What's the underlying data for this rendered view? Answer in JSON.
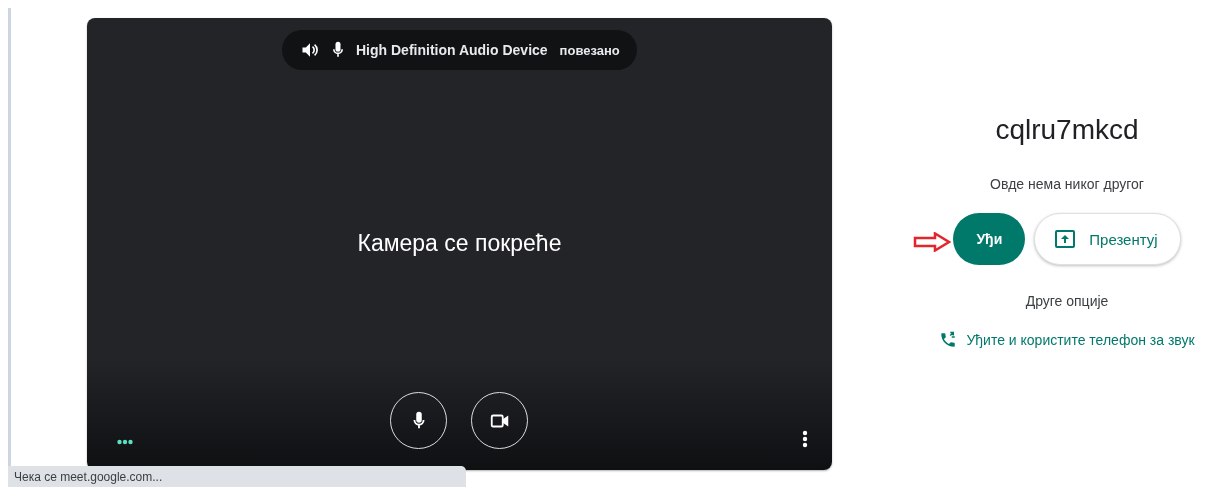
{
  "audio_pill": {
    "device": "High Definition Audio Device",
    "status": "повезано"
  },
  "preview": {
    "message": "Камера се покреће"
  },
  "controls": [
    {
      "kind": "mic"
    },
    {
      "kind": "camera"
    }
  ],
  "meeting": {
    "code": "cqlru7mkcd",
    "note": "Овде нема никог другог"
  },
  "buttons": [
    {
      "kind": "primary",
      "label": "Уђи"
    },
    {
      "kind": "secondary",
      "label": "Презентуј"
    }
  ],
  "other_options": "Друге опције",
  "phone_link": "Уђите и користите телефон за звук",
  "status_bar": "Чека се meet.google.com..."
}
